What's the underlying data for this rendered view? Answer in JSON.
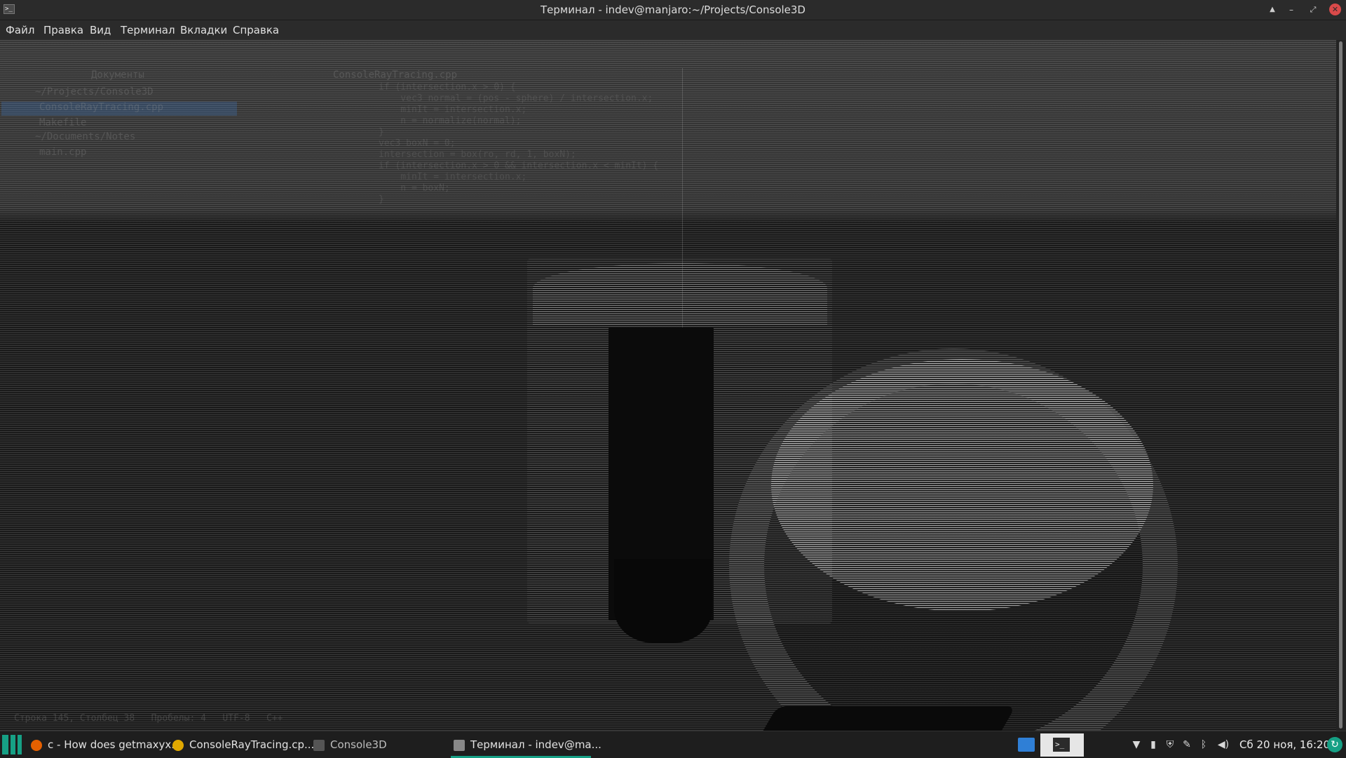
{
  "window": {
    "title": "Терминал - indev@manjaro:~/Projects/Console3D",
    "app_icon": "terminal-icon",
    "controls": {
      "keep_above": "▲",
      "minimize": "–",
      "maximize": "⤢",
      "close": "✕"
    }
  },
  "menubar": {
    "items": [
      {
        "label": "Файл"
      },
      {
        "label": "Правка"
      },
      {
        "label": "Вид"
      },
      {
        "label": "Терминал"
      },
      {
        "label": "Вкладки"
      },
      {
        "label": "Справка"
      }
    ]
  },
  "terminal": {
    "side_panel": {
      "header": "Документы",
      "tab": "ConsoleRayTracing.cpp",
      "items": [
        "~/Projects/Console3D",
        "ConsoleRayTracing.cpp",
        "Makefile",
        "~/Documents/Notes",
        "main.cpp"
      ]
    },
    "code_lines": [
      "if (intersection.x > 0) {",
      "    vec3 normal = (pos - sphere) / intersection.x;",
      "    minIt = intersection.x;",
      "    n = normalize(normal);",
      "}",
      "vec3 boxN = 0;",
      "intersection = box(ro, rd, 1, boxN);",
      "if (intersection.x > 0 && intersection.x < minIt) {",
      "    minIt = intersection.x;",
      "    n = boxN;",
      "}"
    ],
    "status_line": "Строка 145, Столбец 38   Пробелы: 4   UTF-8   C++"
  },
  "taskbar": {
    "tasks": [
      {
        "label": "c - How does getmaxyx...",
        "icon": "firefox-icon",
        "color": "#e66000"
      },
      {
        "label": "ConsoleRayTracing.cp...",
        "icon": "editor-icon",
        "color": "#e0a800"
      },
      {
        "label": "Console3D",
        "icon": "folder-icon",
        "color": "#555555"
      },
      {
        "label": "Терминал - indev@ma...",
        "icon": "terminal-icon",
        "color": "#888888"
      }
    ],
    "tray_icons": [
      "network-icon",
      "battery-icon",
      "security-icon",
      "clip-icon",
      "bluetooth-icon",
      "volume-icon"
    ],
    "clock": "Сб 20 ноя, 16:20",
    "accent": "#16a085"
  }
}
